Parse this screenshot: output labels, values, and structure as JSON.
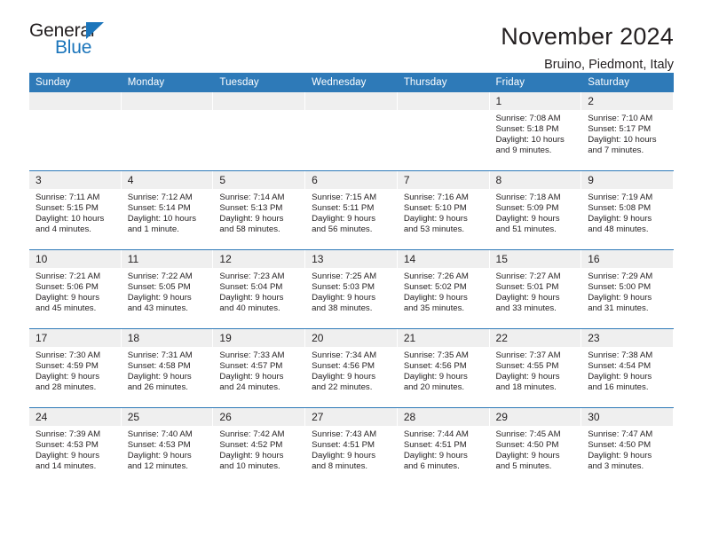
{
  "logo": {
    "word1": "General",
    "word2": "Blue",
    "triangle_color": "#1b75bb",
    "text_color": "#231f20"
  },
  "header": {
    "title": "November 2024",
    "subtitle": "Bruino, Piedmont, Italy"
  },
  "theme": {
    "header_blue": "#2e7ab8",
    "daynum_band": "#efefef",
    "text": "#231f20",
    "page_background": "#ffffff"
  },
  "columns": [
    {
      "label": "Sunday"
    },
    {
      "label": "Monday"
    },
    {
      "label": "Tuesday"
    },
    {
      "label": "Wednesday"
    },
    {
      "label": "Thursday"
    },
    {
      "label": "Friday"
    },
    {
      "label": "Saturday"
    }
  ],
  "labels": {
    "sunrise_prefix": "Sunrise:",
    "sunset_prefix": "Sunset:",
    "daylight_prefix": "Daylight:"
  },
  "weeks": [
    {
      "days": [
        {
          "date": "",
          "blank": true,
          "sunrise": "",
          "sunset": "",
          "daylight_line1": "",
          "daylight_line2": ""
        },
        {
          "date": "",
          "blank": true,
          "sunrise": "",
          "sunset": "",
          "daylight_line1": "",
          "daylight_line2": ""
        },
        {
          "date": "",
          "blank": true,
          "sunrise": "",
          "sunset": "",
          "daylight_line1": "",
          "daylight_line2": ""
        },
        {
          "date": "",
          "blank": true,
          "sunrise": "",
          "sunset": "",
          "daylight_line1": "",
          "daylight_line2": ""
        },
        {
          "date": "",
          "blank": true,
          "sunrise": "",
          "sunset": "",
          "daylight_line1": "",
          "daylight_line2": ""
        },
        {
          "date": "1",
          "blank": false,
          "sunrise": "Sunrise: 7:08 AM",
          "sunset": "Sunset: 5:18 PM",
          "daylight_line1": "Daylight: 10 hours",
          "daylight_line2": "and 9 minutes."
        },
        {
          "date": "2",
          "blank": false,
          "sunrise": "Sunrise: 7:10 AM",
          "sunset": "Sunset: 5:17 PM",
          "daylight_line1": "Daylight: 10 hours",
          "daylight_line2": "and 7 minutes."
        }
      ]
    },
    {
      "days": [
        {
          "date": "3",
          "blank": false,
          "sunrise": "Sunrise: 7:11 AM",
          "sunset": "Sunset: 5:15 PM",
          "daylight_line1": "Daylight: 10 hours",
          "daylight_line2": "and 4 minutes."
        },
        {
          "date": "4",
          "blank": false,
          "sunrise": "Sunrise: 7:12 AM",
          "sunset": "Sunset: 5:14 PM",
          "daylight_line1": "Daylight: 10 hours",
          "daylight_line2": "and 1 minute."
        },
        {
          "date": "5",
          "blank": false,
          "sunrise": "Sunrise: 7:14 AM",
          "sunset": "Sunset: 5:13 PM",
          "daylight_line1": "Daylight: 9 hours",
          "daylight_line2": "and 58 minutes."
        },
        {
          "date": "6",
          "blank": false,
          "sunrise": "Sunrise: 7:15 AM",
          "sunset": "Sunset: 5:11 PM",
          "daylight_line1": "Daylight: 9 hours",
          "daylight_line2": "and 56 minutes."
        },
        {
          "date": "7",
          "blank": false,
          "sunrise": "Sunrise: 7:16 AM",
          "sunset": "Sunset: 5:10 PM",
          "daylight_line1": "Daylight: 9 hours",
          "daylight_line2": "and 53 minutes."
        },
        {
          "date": "8",
          "blank": false,
          "sunrise": "Sunrise: 7:18 AM",
          "sunset": "Sunset: 5:09 PM",
          "daylight_line1": "Daylight: 9 hours",
          "daylight_line2": "and 51 minutes."
        },
        {
          "date": "9",
          "blank": false,
          "sunrise": "Sunrise: 7:19 AM",
          "sunset": "Sunset: 5:08 PM",
          "daylight_line1": "Daylight: 9 hours",
          "daylight_line2": "and 48 minutes."
        }
      ]
    },
    {
      "days": [
        {
          "date": "10",
          "blank": false,
          "sunrise": "Sunrise: 7:21 AM",
          "sunset": "Sunset: 5:06 PM",
          "daylight_line1": "Daylight: 9 hours",
          "daylight_line2": "and 45 minutes."
        },
        {
          "date": "11",
          "blank": false,
          "sunrise": "Sunrise: 7:22 AM",
          "sunset": "Sunset: 5:05 PM",
          "daylight_line1": "Daylight: 9 hours",
          "daylight_line2": "and 43 minutes."
        },
        {
          "date": "12",
          "blank": false,
          "sunrise": "Sunrise: 7:23 AM",
          "sunset": "Sunset: 5:04 PM",
          "daylight_line1": "Daylight: 9 hours",
          "daylight_line2": "and 40 minutes."
        },
        {
          "date": "13",
          "blank": false,
          "sunrise": "Sunrise: 7:25 AM",
          "sunset": "Sunset: 5:03 PM",
          "daylight_line1": "Daylight: 9 hours",
          "daylight_line2": "and 38 minutes."
        },
        {
          "date": "14",
          "blank": false,
          "sunrise": "Sunrise: 7:26 AM",
          "sunset": "Sunset: 5:02 PM",
          "daylight_line1": "Daylight: 9 hours",
          "daylight_line2": "and 35 minutes."
        },
        {
          "date": "15",
          "blank": false,
          "sunrise": "Sunrise: 7:27 AM",
          "sunset": "Sunset: 5:01 PM",
          "daylight_line1": "Daylight: 9 hours",
          "daylight_line2": "and 33 minutes."
        },
        {
          "date": "16",
          "blank": false,
          "sunrise": "Sunrise: 7:29 AM",
          "sunset": "Sunset: 5:00 PM",
          "daylight_line1": "Daylight: 9 hours",
          "daylight_line2": "and 31 minutes."
        }
      ]
    },
    {
      "days": [
        {
          "date": "17",
          "blank": false,
          "sunrise": "Sunrise: 7:30 AM",
          "sunset": "Sunset: 4:59 PM",
          "daylight_line1": "Daylight: 9 hours",
          "daylight_line2": "and 28 minutes."
        },
        {
          "date": "18",
          "blank": false,
          "sunrise": "Sunrise: 7:31 AM",
          "sunset": "Sunset: 4:58 PM",
          "daylight_line1": "Daylight: 9 hours",
          "daylight_line2": "and 26 minutes."
        },
        {
          "date": "19",
          "blank": false,
          "sunrise": "Sunrise: 7:33 AM",
          "sunset": "Sunset: 4:57 PM",
          "daylight_line1": "Daylight: 9 hours",
          "daylight_line2": "and 24 minutes."
        },
        {
          "date": "20",
          "blank": false,
          "sunrise": "Sunrise: 7:34 AM",
          "sunset": "Sunset: 4:56 PM",
          "daylight_line1": "Daylight: 9 hours",
          "daylight_line2": "and 22 minutes."
        },
        {
          "date": "21",
          "blank": false,
          "sunrise": "Sunrise: 7:35 AM",
          "sunset": "Sunset: 4:56 PM",
          "daylight_line1": "Daylight: 9 hours",
          "daylight_line2": "and 20 minutes."
        },
        {
          "date": "22",
          "blank": false,
          "sunrise": "Sunrise: 7:37 AM",
          "sunset": "Sunset: 4:55 PM",
          "daylight_line1": "Daylight: 9 hours",
          "daylight_line2": "and 18 minutes."
        },
        {
          "date": "23",
          "blank": false,
          "sunrise": "Sunrise: 7:38 AM",
          "sunset": "Sunset: 4:54 PM",
          "daylight_line1": "Daylight: 9 hours",
          "daylight_line2": "and 16 minutes."
        }
      ]
    },
    {
      "days": [
        {
          "date": "24",
          "blank": false,
          "sunrise": "Sunrise: 7:39 AM",
          "sunset": "Sunset: 4:53 PM",
          "daylight_line1": "Daylight: 9 hours",
          "daylight_line2": "and 14 minutes."
        },
        {
          "date": "25",
          "blank": false,
          "sunrise": "Sunrise: 7:40 AM",
          "sunset": "Sunset: 4:53 PM",
          "daylight_line1": "Daylight: 9 hours",
          "daylight_line2": "and 12 minutes."
        },
        {
          "date": "26",
          "blank": false,
          "sunrise": "Sunrise: 7:42 AM",
          "sunset": "Sunset: 4:52 PM",
          "daylight_line1": "Daylight: 9 hours",
          "daylight_line2": "and 10 minutes."
        },
        {
          "date": "27",
          "blank": false,
          "sunrise": "Sunrise: 7:43 AM",
          "sunset": "Sunset: 4:51 PM",
          "daylight_line1": "Daylight: 9 hours",
          "daylight_line2": "and 8 minutes."
        },
        {
          "date": "28",
          "blank": false,
          "sunrise": "Sunrise: 7:44 AM",
          "sunset": "Sunset: 4:51 PM",
          "daylight_line1": "Daylight: 9 hours",
          "daylight_line2": "and 6 minutes."
        },
        {
          "date": "29",
          "blank": false,
          "sunrise": "Sunrise: 7:45 AM",
          "sunset": "Sunset: 4:50 PM",
          "daylight_line1": "Daylight: 9 hours",
          "daylight_line2": "and 5 minutes."
        },
        {
          "date": "30",
          "blank": false,
          "sunrise": "Sunrise: 7:47 AM",
          "sunset": "Sunset: 4:50 PM",
          "daylight_line1": "Daylight: 9 hours",
          "daylight_line2": "and 3 minutes."
        }
      ]
    }
  ]
}
